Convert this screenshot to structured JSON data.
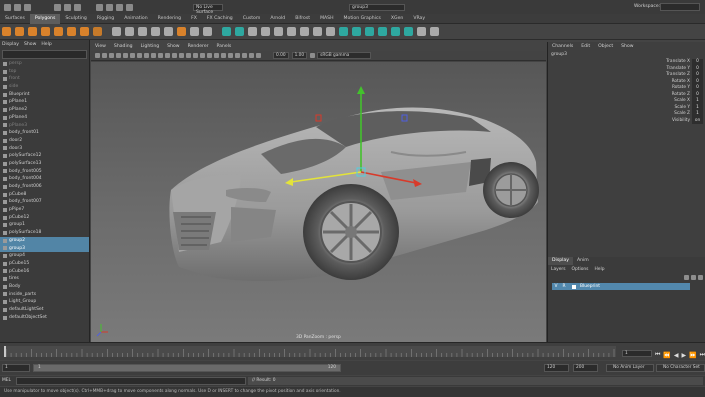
{
  "menubar": {
    "mode_value": "No Live Surface",
    "object_name": "group3",
    "workspace_label": "Workspace:"
  },
  "shelf": {
    "tabs": [
      "Surfaces",
      "Polygons",
      "Sculpting",
      "Rigging",
      "Animation",
      "Rendering",
      "FX",
      "FX Caching",
      "Custom",
      "Arnold",
      "Bifrost",
      "MASH",
      "Motion Graphics",
      "XGen",
      "VRay"
    ],
    "active_tab": "Polygons"
  },
  "outliner": {
    "menu": [
      "Display",
      "Show",
      "Help"
    ],
    "items": [
      {
        "label": "persp",
        "state": "dim"
      },
      {
        "label": "top",
        "state": "dim"
      },
      {
        "label": "front",
        "state": "dim"
      },
      {
        "label": "side",
        "state": "dim"
      },
      {
        "label": "Blueprint",
        "state": ""
      },
      {
        "label": "pPlane1",
        "state": ""
      },
      {
        "label": "pPlane2",
        "state": ""
      },
      {
        "label": "pPlane4",
        "state": ""
      },
      {
        "label": "pPlane3",
        "state": "dim"
      },
      {
        "label": "body_front01",
        "state": ""
      },
      {
        "label": "door2",
        "state": ""
      },
      {
        "label": "door3",
        "state": ""
      },
      {
        "label": "polySurface12",
        "state": ""
      },
      {
        "label": "polySurface13",
        "state": ""
      },
      {
        "label": "body_front005",
        "state": ""
      },
      {
        "label": "body_front004",
        "state": ""
      },
      {
        "label": "body_front006",
        "state": ""
      },
      {
        "label": "pCube8",
        "state": ""
      },
      {
        "label": "body_front007",
        "state": ""
      },
      {
        "label": "pPipe7",
        "state": ""
      },
      {
        "label": "pCube12",
        "state": ""
      },
      {
        "label": "group1",
        "state": ""
      },
      {
        "label": "polySurface18",
        "state": ""
      },
      {
        "label": "group2",
        "state": "sel"
      },
      {
        "label": "group3",
        "state": "sel"
      },
      {
        "label": "group4",
        "state": ""
      },
      {
        "label": "pCube15",
        "state": ""
      },
      {
        "label": "pCube16",
        "state": ""
      },
      {
        "label": "tires",
        "state": ""
      },
      {
        "label": "Body",
        "state": ""
      },
      {
        "label": "inside_parts",
        "state": ""
      },
      {
        "label": "Light_Group",
        "state": ""
      },
      {
        "label": "defaultLightSet",
        "state": ""
      },
      {
        "label": "defaultObjectSet",
        "state": ""
      }
    ]
  },
  "viewport": {
    "menu": [
      "View",
      "Shading",
      "Lighting",
      "Show",
      "Renderer",
      "Panels"
    ],
    "near_value": "0.00",
    "far_value": "1.00",
    "color_space": "sRGB gamma",
    "camera_label": "3D PanZoom : persp"
  },
  "channel_box": {
    "menu": [
      "Channels",
      "Edit",
      "Object",
      "Show"
    ],
    "object": "group3",
    "attributes": [
      {
        "name": "Translate X",
        "value": "0"
      },
      {
        "name": "Translate Y",
        "value": "0"
      },
      {
        "name": "Translate Z",
        "value": "0"
      },
      {
        "name": "Rotate X",
        "value": "0"
      },
      {
        "name": "Rotate Y",
        "value": "0"
      },
      {
        "name": "Rotate Z",
        "value": "0"
      },
      {
        "name": "Scale X",
        "value": "1"
      },
      {
        "name": "Scale Y",
        "value": "1"
      },
      {
        "name": "Scale Z",
        "value": "1"
      },
      {
        "name": "Visibility",
        "value": "on"
      }
    ]
  },
  "layer_editor": {
    "tabs": [
      "Display",
      "Anim"
    ],
    "active_tab": "Display",
    "menu": [
      "Layers",
      "Options",
      "Help"
    ],
    "layers": [
      {
        "name": "Blueprint",
        "visible": "V",
        "type": "R"
      }
    ]
  },
  "timeline": {
    "current_frame": "1",
    "range_start": "1",
    "range_start_inner": "1",
    "range_end_inner": "120",
    "range_end": "120",
    "range_end_outer": "200",
    "anim_layer": "No Anim Layer",
    "character_set": "No Character Set"
  },
  "command": {
    "lang": "MEL",
    "result": "// Result: 0"
  },
  "helpline": {
    "text": "Use manipulator to move object(s). Ctrl+MMB+drag to move components along normals. Use D or INSERT to change the pivot position and axis orientation."
  },
  "colors": {
    "selection": "#5285a6",
    "axis_x": "#d83a2a",
    "axis_y": "#43c22c",
    "axis_z": "#e3e33a"
  }
}
